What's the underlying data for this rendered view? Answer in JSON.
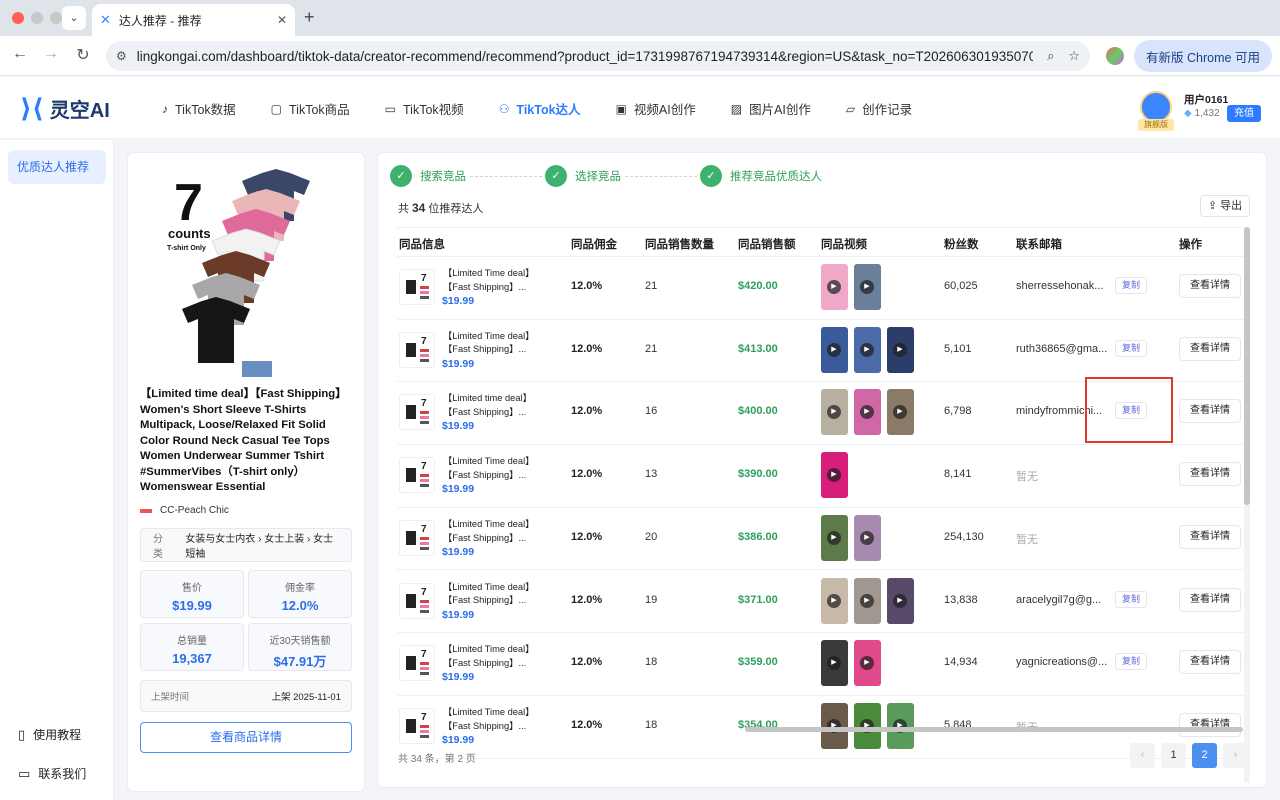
{
  "browser": {
    "tab_title": "达人推荐 - 推荐",
    "url": "lingkongai.com/dashboard/tiktok-data/creator-recommend/recommend?product_id=1731998767194739314&region=US&task_no=T2026063019350700...",
    "update_label": "有新版 Chrome 可用"
  },
  "header": {
    "logo_text": "灵空AI",
    "nav": [
      {
        "label": "TikTok数据",
        "icon": "tiktok-icon"
      },
      {
        "label": "TikTok商品",
        "icon": "bag-icon"
      },
      {
        "label": "TikTok视频",
        "icon": "video-icon"
      },
      {
        "label": "TikTok达人",
        "icon": "users-icon"
      },
      {
        "label": "视频AI创作",
        "icon": "ai-video-icon"
      },
      {
        "label": "图片AI创作",
        "icon": "image-icon"
      },
      {
        "label": "创作记录",
        "icon": "folder-icon"
      }
    ],
    "user": {
      "name": "用户0161",
      "badge": "旗舰版",
      "points": "1,432",
      "recharge": "充值"
    }
  },
  "sidebar": {
    "active": "优质达人推荐",
    "footer": [
      {
        "label": "使用教程",
        "icon": "book-icon"
      },
      {
        "label": "联系我们",
        "icon": "chat-icon"
      }
    ]
  },
  "product": {
    "img_count": "7",
    "img_counts_label": "counts",
    "img_sub": "T-shirt Only",
    "title": "【Limited time deal】【Fast Shipping】Women's Short Sleeve T-Shirts Multipack, Loose/Relaxed Fit Solid Color Round Neck Casual Tee Tops Women Underwear Summer Tshirt #SummerVibes（T-shirt only）Womenswear Essential",
    "shop": "CC-Peach Chic",
    "category_label": "分类",
    "category": "女装与女士内衣 › 女士上装 › 女士短袖",
    "stats": [
      {
        "label": "售价",
        "value": "$19.99"
      },
      {
        "label": "佣金率",
        "value": "12.0%"
      },
      {
        "label": "总销量",
        "value": "19,367"
      },
      {
        "label": "近30天销售额",
        "value": "$47.91万"
      }
    ],
    "listed_label": "上架时间",
    "listed_value": "上架 2025-11-01",
    "detail_button": "查看商品详情"
  },
  "steps": [
    "搜索竞品",
    "选择竞品",
    "推荐竞品优质达人"
  ],
  "summary": {
    "prefix": "共",
    "count": "34",
    "suffix": "位推荐达人"
  },
  "export_label": "导出",
  "columns": [
    "同品信息",
    "同品佣金",
    "同品销售数量",
    "同品销售额",
    "同品视频",
    "粉丝数",
    "联系邮箱",
    "操作"
  ],
  "copy_label": "复制",
  "view_label": "查看详情",
  "rows": [
    {
      "line1": "【Limited Time deal】",
      "line2": "【Fast Shipping】...",
      "price": "$19.99",
      "commission": "12.0%",
      "qty": "21",
      "amount": "$420.00",
      "videos": [
        "#f0a8c8",
        "#6a7f9a"
      ],
      "fans": "60,025",
      "email": "sherressehonak...",
      "has_email": true
    },
    {
      "line1": "【Limited Time deal】",
      "line2": "【Fast Shipping】...",
      "price": "$19.99",
      "commission": "12.0%",
      "qty": "21",
      "amount": "$413.00",
      "videos": [
        "#3a5a9a",
        "#4a6aa8",
        "#2d3d6a"
      ],
      "fans": "5,101",
      "email": "ruth36865@gma...",
      "has_email": true
    },
    {
      "line1": "【Limited time deal】",
      "line2": "【Fast Shipping】...",
      "price": "$19.99",
      "commission": "12.0%",
      "qty": "16",
      "amount": "$400.00",
      "videos": [
        "#b7b0a0",
        "#d068a8",
        "#8a7a68"
      ],
      "fans": "6,798",
      "email": "mindyfrommichi...",
      "has_email": true
    },
    {
      "line1": "【Limited Time deal】",
      "line2": "【Fast Shipping】...",
      "price": "$19.99",
      "commission": "12.0%",
      "qty": "13",
      "amount": "$390.00",
      "videos": [
        "#d81d7a"
      ],
      "fans": "8,141",
      "email": "暂无",
      "has_email": false
    },
    {
      "line1": "【Limited Time deal】",
      "line2": "【Fast Shipping】...",
      "price": "$19.99",
      "commission": "12.0%",
      "qty": "20",
      "amount": "$386.00",
      "videos": [
        "#5c7a4a",
        "#a88ab0"
      ],
      "fans": "254,130",
      "email": "暂无",
      "has_email": false
    },
    {
      "line1": "【Limited Time deal】",
      "line2": "【Fast Shipping】...",
      "price": "$19.99",
      "commission": "12.0%",
      "qty": "19",
      "amount": "$371.00",
      "videos": [
        "#c8b8a8",
        "#a09890",
        "#5a4a6a"
      ],
      "fans": "13,838",
      "email": "aracelygil7g@g...",
      "has_email": true
    },
    {
      "line1": "【Limited Time deal】",
      "line2": "【Fast Shipping】...",
      "price": "$19.99",
      "commission": "12.0%",
      "qty": "18",
      "amount": "$359.00",
      "videos": [
        "#3a3a3a",
        "#e04a8a"
      ],
      "fans": "14,934",
      "email": "yagnicreations@...",
      "has_email": true
    },
    {
      "line1": "【Limited Time deal】",
      "line2": "【Fast Shipping】...",
      "price": "$19.99",
      "commission": "12.0%",
      "qty": "18",
      "amount": "$354.00",
      "videos": [
        "#6a5a4a",
        "#4a8a3a",
        "#5a9a5a"
      ],
      "fans": "5,848",
      "email": "暂无",
      "has_email": false
    }
  ],
  "pagination": {
    "info": "共 34 条，第 2 页",
    "pages": [
      "1",
      "2"
    ],
    "current": "2",
    "prev": "‹",
    "next": "›"
  },
  "colors": {
    "accent": "#2b7cff",
    "success": "#2f9e5c",
    "highlight": "#e03a2f"
  }
}
